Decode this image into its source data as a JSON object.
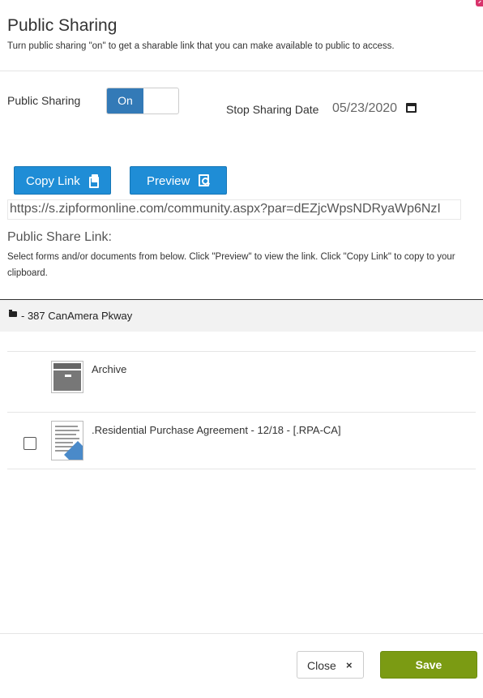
{
  "header": {
    "title": "Public Sharing",
    "subtitle": "Turn public sharing \"on\" to get a sharable link that you can make available to public to access."
  },
  "sharing": {
    "label": "Public Sharing",
    "toggle_state": "On",
    "stop_date_label": "Stop Sharing Date",
    "stop_date_value": "05/23/2020"
  },
  "actions": {
    "copy_label": "Copy Link",
    "preview_label": "Preview"
  },
  "link": {
    "url": "https://s.zipformonline.com/community.aspx?par=dEZjcWpsNDRyaWp6NzI",
    "label": "Public Share Link:",
    "help_text": "Select forms and/or documents from below. Click \"Preview\" to view the link. Click \"Copy Link\" to copy to your clipboard."
  },
  "folder": {
    "name": "- 387 CanAmera Pkway"
  },
  "items": [
    {
      "name": "Archive",
      "type": "folder",
      "checkbox": false
    },
    {
      "name": ".Residential Purchase Agreement - 12/18 - [.RPA-CA]",
      "type": "document",
      "checkbox": true,
      "checked": false
    }
  ],
  "footer": {
    "close_label": "Close",
    "save_label": "Save"
  },
  "colors": {
    "toggle_on": "#337ab7",
    "primary_button": "#1f8dd6",
    "save_button": "#7b9b13"
  },
  "icons": [
    "copy-icon",
    "preview-icon",
    "calendar-icon",
    "folder-icon",
    "archive-icon",
    "document-thumbnail",
    "close-icon"
  ]
}
